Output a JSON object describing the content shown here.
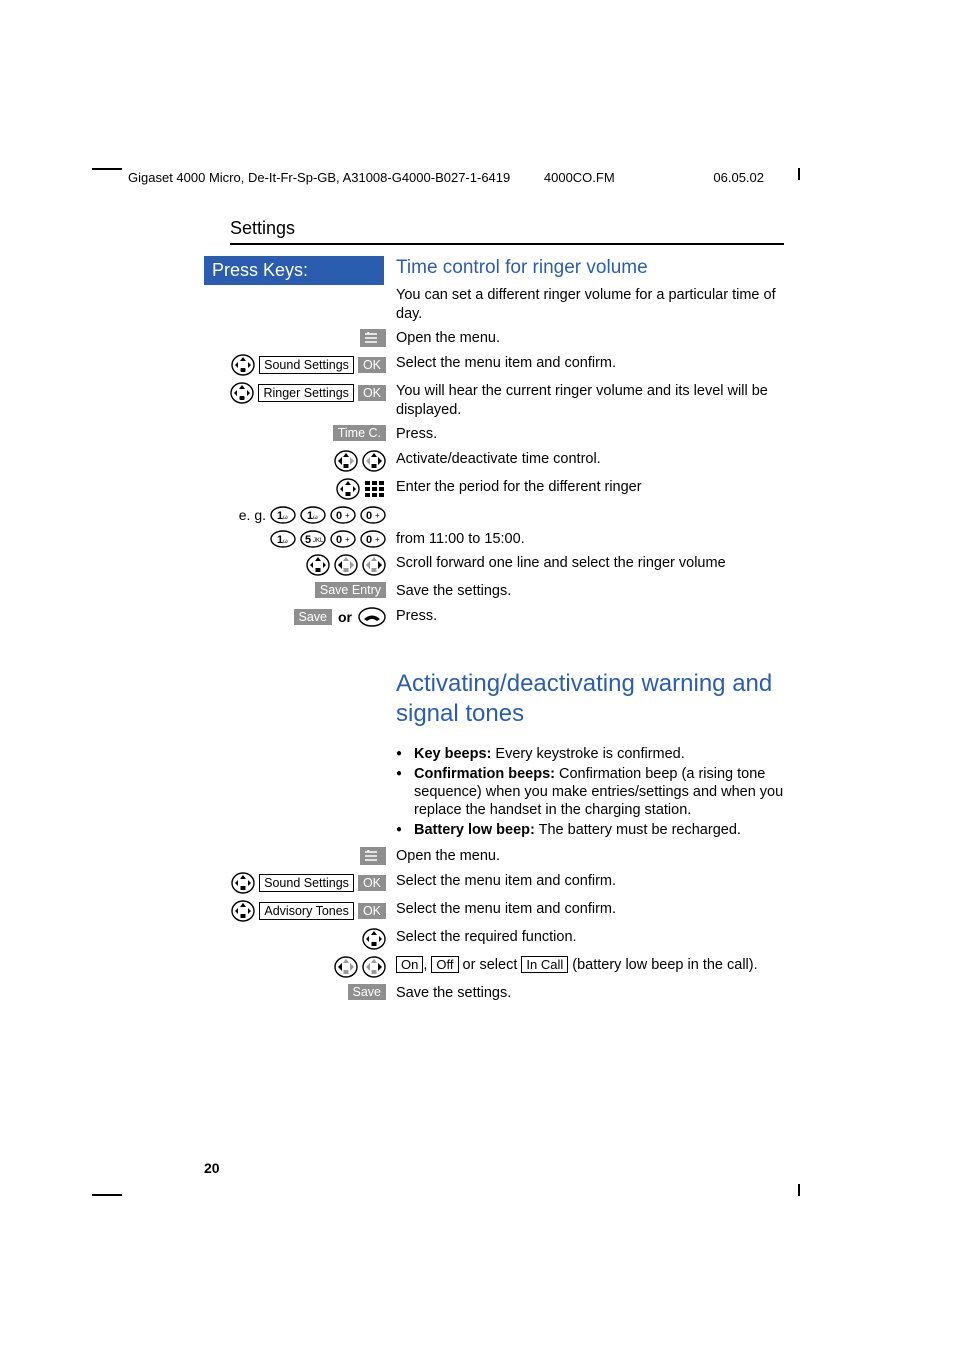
{
  "header": {
    "doc_id": "Gigaset 4000 Micro, De-It-Fr-Sp-GB, A31008-G4000-B027-1-6419",
    "file": "4000CO.FM",
    "date": "06.05.02"
  },
  "page_title": "Settings",
  "press_keys_label": "Press Keys:",
  "section1": {
    "heading": "Time control for ringer volume",
    "intro": "You can set a different ringer volume for a particular time of day.",
    "rows": {
      "open_menu": "Open the menu.",
      "sound_settings_label": "Sound Settings",
      "ok": "OK",
      "sound_settings_desc": "Select the menu item and confirm.",
      "ringer_settings_label": "Ringer Settings",
      "ringer_settings_desc": "You will hear the current ringer volume and its level will be displayed.",
      "timec_label": "Time C.",
      "timec_desc": "Press.",
      "activate_desc": "Activate/deactivate time control.",
      "period_desc": "Enter the period for the different ringer",
      "eg_label": "e. g.",
      "from_desc": "from 11:00 to 15:00.",
      "scroll_desc": "Scroll forward one line and select the ringer volume",
      "save_entry_label": "Save Entry",
      "save_entry_desc": "Save the settings.",
      "save_label": "Save",
      "or": "or",
      "press_desc": "Press."
    }
  },
  "section2": {
    "heading": "Activating/deactivating warning and signal tones",
    "bullets": {
      "b1_bold": "Key beeps:",
      "b1_rest": " Every keystroke is confirmed.",
      "b2_bold": "Confirmation beeps:",
      "b2_rest": " Confirmation beep (a rising tone sequence) when you make entries/settings and when you replace the handset in the charging station.",
      "b3_bold": "Battery low beep:",
      "b3_rest": " The battery must be recharged."
    },
    "rows": {
      "open_menu": "Open the menu.",
      "sound_settings_label": "Sound Settings",
      "ok": "OK",
      "sound_settings_desc": "Select the menu item and confirm.",
      "advisory_label": "Advisory Tones",
      "advisory_desc": "Select the menu item and confirm.",
      "select_func_desc": "Select the required function.",
      "on": "On",
      "off": "Off",
      "in_call": "In Call",
      "toggle_desc_mid": " or select ",
      "toggle_desc_end": " (battery low beep in the call).",
      "save_label": "Save",
      "save_desc": "Save the settings."
    }
  },
  "page_number": "20"
}
